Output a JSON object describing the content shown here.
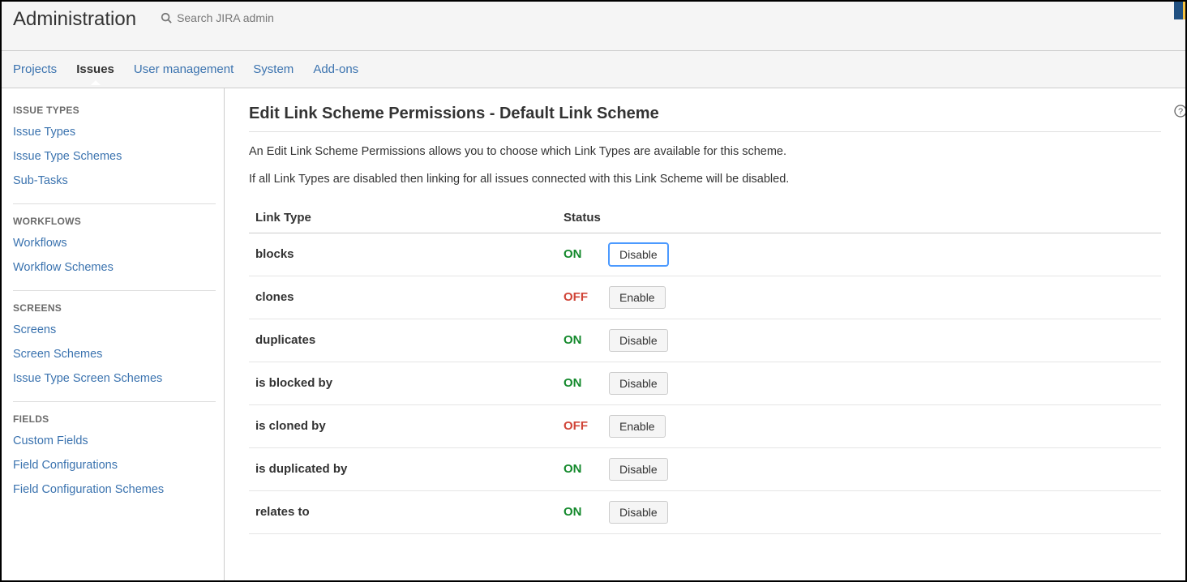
{
  "header": {
    "title": "Administration",
    "search_placeholder": "Search JIRA admin"
  },
  "nav": {
    "tabs": [
      {
        "label": "Projects",
        "active": false
      },
      {
        "label": "Issues",
        "active": true
      },
      {
        "label": "User management",
        "active": false
      },
      {
        "label": "System",
        "active": false
      },
      {
        "label": "Add-ons",
        "active": false
      }
    ]
  },
  "sidebar": {
    "groups": [
      {
        "heading": "ISSUE TYPES",
        "items": [
          "Issue Types",
          "Issue Type Schemes",
          "Sub-Tasks"
        ]
      },
      {
        "heading": "WORKFLOWS",
        "items": [
          "Workflows",
          "Workflow Schemes"
        ]
      },
      {
        "heading": "SCREENS",
        "items": [
          "Screens",
          "Screen Schemes",
          "Issue Type Screen Schemes"
        ]
      },
      {
        "heading": "FIELDS",
        "items": [
          "Custom Fields",
          "Field Configurations",
          "Field Configuration Schemes"
        ]
      }
    ]
  },
  "main": {
    "title": "Edit Link Scheme Permissions - Default Link Scheme",
    "desc1": "An Edit Link Scheme Permissions allows you to choose which Link Types are available for this scheme.",
    "desc2": "If all Link Types are disabled then linking for all issues connected with this Link Scheme will be disabled.",
    "col_linktype": "Link Type",
    "col_status": "Status",
    "rows": [
      {
        "name": "blocks",
        "status": "ON",
        "action": "Disable",
        "focus": true
      },
      {
        "name": "clones",
        "status": "OFF",
        "action": "Enable",
        "focus": false
      },
      {
        "name": "duplicates",
        "status": "ON",
        "action": "Disable",
        "focus": false
      },
      {
        "name": "is blocked by",
        "status": "ON",
        "action": "Disable",
        "focus": false
      },
      {
        "name": "is cloned by",
        "status": "OFF",
        "action": "Enable",
        "focus": false
      },
      {
        "name": "is duplicated by",
        "status": "ON",
        "action": "Disable",
        "focus": false
      },
      {
        "name": "relates to",
        "status": "ON",
        "action": "Disable",
        "focus": false
      }
    ]
  }
}
